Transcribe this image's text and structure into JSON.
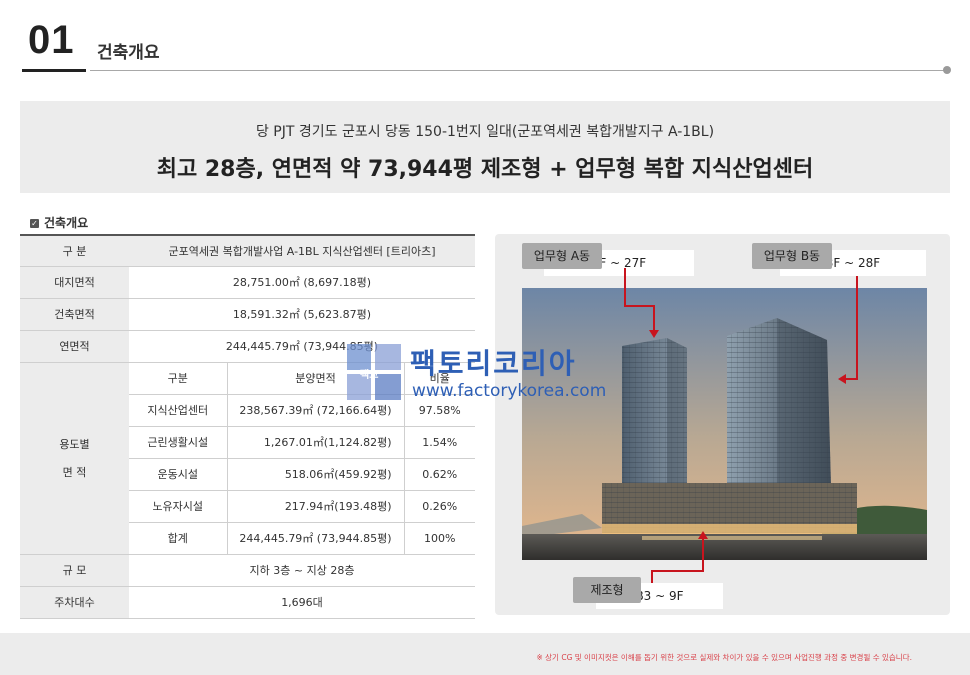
{
  "header": {
    "number": "01",
    "title": "건축개요"
  },
  "banner": {
    "subtitle": "당 PJT 경기도 군포시 당동 150-1번지 일대(군포역세권 복합개발지구 A-1BL)",
    "headline": "최고 28층, 연면적 약 73,944평 제조형 + 업무형 복합 지식산업센터"
  },
  "section_label": "건축개요",
  "table": {
    "head": {
      "label": "구 분",
      "value": "군포역세권 복합개발사업 A-1BL 지식산업센터 [트리아츠]"
    },
    "site_area": {
      "label": "대지면적",
      "value": "28,751.00㎡ (8,697.18평)"
    },
    "building_area": {
      "label": "건축면적",
      "value": "18,591.32㎡ (5,623.87평)"
    },
    "gross_area": {
      "label": "연면적",
      "value": "244,445.79㎡ (73,944.85평)"
    },
    "use_label_1": "용도별",
    "use_label_2": "면 적",
    "use_headers": {
      "type": "구분",
      "area": "분양면적",
      "ratio": "비율"
    },
    "use_rows": [
      {
        "type": "지식산업센터",
        "area": "238,567.39㎡ (72,166.64평)",
        "ratio": "97.58%"
      },
      {
        "type": "근린생활시설",
        "area": "1,267.01㎡(1,124.82평)",
        "ratio": "1.54%"
      },
      {
        "type": "운동시설",
        "area": "518.06㎡(459.92평)",
        "ratio": "0.62%"
      },
      {
        "type": "노유자시설",
        "area": "217.94㎡(193.48평)",
        "ratio": "0.26%"
      },
      {
        "type": "합계",
        "area": "244,445.79㎡ (73,944.85평)",
        "ratio": "100%"
      }
    ],
    "scale": {
      "label": "규 모",
      "value": "지하 3층 ~ 지상 28층"
    },
    "parking": {
      "label": "주차대수",
      "value": "1,696대"
    }
  },
  "image_panel": {
    "tag_a": "업무형 A동",
    "range_a": "1F ~ 27F",
    "tag_b": "업무형 B동",
    "range_b": "3F ~ 28F",
    "tag_c": "제조형",
    "range_c": "B3 ~ 9F"
  },
  "watermark": {
    "brand": "팩토리코리아",
    "mark": "팩코",
    "url": "www.factorykorea.com"
  },
  "footnote": "※ 상기 CG 및 이미지컷은 이해를 돕기 위한 것으로 실제와 차이가 있을 수 있으며 사업진행 과정 중 변경될 수 있습니다.",
  "colors": {
    "accent_red": "#c8141e",
    "watermark_blue": "#2e5fb5",
    "panel_gray": "#ececec"
  }
}
